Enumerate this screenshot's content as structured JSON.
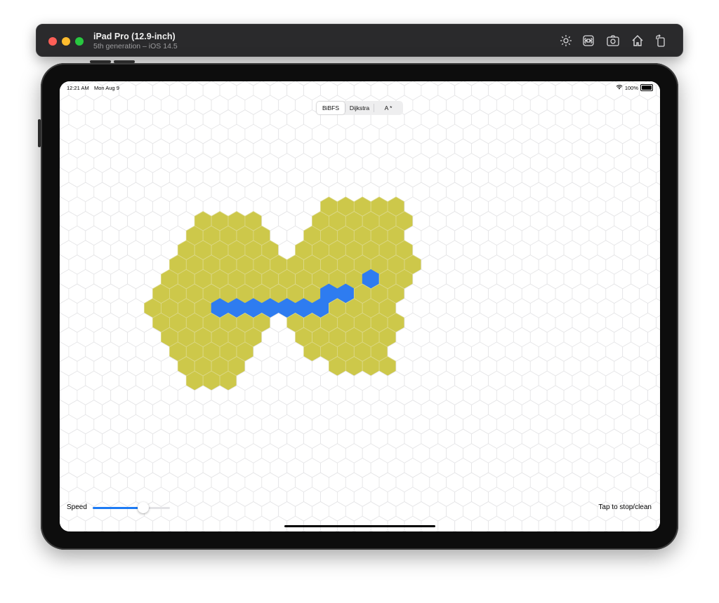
{
  "window": {
    "title": "iPad Pro (12.9-inch)",
    "subtitle": "5th generation – iOS 14.5",
    "toolbar_icons": [
      "brightness-icon",
      "command-icon",
      "screenshot-icon",
      "home-icon",
      "rotate-icon"
    ]
  },
  "status_bar": {
    "time": "12:21 AM",
    "date": "Mon Aug 9",
    "battery": "100%"
  },
  "segmented_control": {
    "options": [
      "BiBFS",
      "Dijkstra",
      "A *"
    ],
    "selected": "BiBFS"
  },
  "hex_grid": {
    "colors": {
      "empty_fill": "#ffffff",
      "empty_stroke": "#e4e4e6",
      "visited": "#cdc84a",
      "path": "#2e7cf0",
      "visited_stroke": "#dcd98a"
    },
    "visited_cells": [
      [
        3,
        9
      ],
      [
        4,
        9
      ],
      [
        5,
        9
      ],
      [
        6,
        9
      ],
      [
        3,
        10
      ],
      [
        4,
        10
      ],
      [
        5,
        10
      ],
      [
        6,
        10
      ],
      [
        7,
        10
      ],
      [
        2,
        11
      ],
      [
        3,
        11
      ],
      [
        4,
        11
      ],
      [
        5,
        11
      ],
      [
        6,
        11
      ],
      [
        7,
        11
      ],
      [
        2,
        12
      ],
      [
        3,
        12
      ],
      [
        4,
        12
      ],
      [
        5,
        12
      ],
      [
        6,
        12
      ],
      [
        7,
        12
      ],
      [
        8,
        12
      ],
      [
        1,
        13
      ],
      [
        2,
        13
      ],
      [
        3,
        13
      ],
      [
        4,
        13
      ],
      [
        5,
        13
      ],
      [
        6,
        13
      ],
      [
        7,
        13
      ],
      [
        8,
        13
      ],
      [
        1,
        14
      ],
      [
        2,
        14
      ],
      [
        3,
        14
      ],
      [
        4,
        14
      ],
      [
        5,
        14
      ],
      [
        6,
        14
      ],
      [
        7,
        14
      ],
      [
        8,
        14
      ],
      [
        9,
        14
      ],
      [
        0,
        15
      ],
      [
        1,
        15
      ],
      [
        2,
        15
      ],
      [
        3,
        15
      ],
      [
        4,
        15
      ],
      [
        5,
        15
      ],
      [
        6,
        15
      ],
      [
        7,
        15
      ],
      [
        8,
        15
      ],
      [
        1,
        16
      ],
      [
        2,
        16
      ],
      [
        3,
        16
      ],
      [
        4,
        16
      ],
      [
        5,
        16
      ],
      [
        6,
        16
      ],
      [
        7,
        16
      ],
      [
        1,
        17
      ],
      [
        2,
        17
      ],
      [
        3,
        17
      ],
      [
        4,
        17
      ],
      [
        5,
        17
      ],
      [
        6,
        17
      ],
      [
        2,
        18
      ],
      [
        3,
        18
      ],
      [
        4,
        18
      ],
      [
        5,
        18
      ],
      [
        6,
        18
      ],
      [
        2,
        19
      ],
      [
        3,
        19
      ],
      [
        4,
        19
      ],
      [
        5,
        19
      ],
      [
        3,
        20
      ],
      [
        4,
        20
      ],
      [
        5,
        20
      ],
      [
        11,
        8
      ],
      [
        12,
        8
      ],
      [
        13,
        8
      ],
      [
        14,
        8
      ],
      [
        15,
        8
      ],
      [
        10,
        9
      ],
      [
        11,
        9
      ],
      [
        12,
        9
      ],
      [
        13,
        9
      ],
      [
        14,
        9
      ],
      [
        15,
        9
      ],
      [
        10,
        10
      ],
      [
        11,
        10
      ],
      [
        12,
        10
      ],
      [
        13,
        10
      ],
      [
        14,
        10
      ],
      [
        15,
        10
      ],
      [
        9,
        11
      ],
      [
        10,
        11
      ],
      [
        11,
        11
      ],
      [
        12,
        11
      ],
      [
        13,
        11
      ],
      [
        14,
        11
      ],
      [
        15,
        11
      ],
      [
        9,
        12
      ],
      [
        10,
        12
      ],
      [
        11,
        12
      ],
      [
        12,
        12
      ],
      [
        13,
        12
      ],
      [
        14,
        12
      ],
      [
        15,
        12
      ],
      [
        16,
        12
      ],
      [
        9,
        13
      ],
      [
        10,
        13
      ],
      [
        11,
        13
      ],
      [
        12,
        13
      ],
      [
        13,
        13
      ],
      [
        14,
        13
      ],
      [
        15,
        13
      ],
      [
        9,
        14
      ],
      [
        10,
        14
      ],
      [
        11,
        14
      ],
      [
        12,
        14
      ],
      [
        13,
        14
      ],
      [
        14,
        14
      ],
      [
        15,
        14
      ],
      [
        9,
        15
      ],
      [
        10,
        15
      ],
      [
        11,
        15
      ],
      [
        12,
        15
      ],
      [
        13,
        15
      ],
      [
        14,
        15
      ],
      [
        9,
        16
      ],
      [
        10,
        16
      ],
      [
        11,
        16
      ],
      [
        12,
        16
      ],
      [
        13,
        16
      ],
      [
        14,
        16
      ],
      [
        15,
        16
      ],
      [
        9,
        17
      ],
      [
        10,
        17
      ],
      [
        11,
        17
      ],
      [
        12,
        17
      ],
      [
        13,
        17
      ],
      [
        14,
        17
      ],
      [
        10,
        18
      ],
      [
        11,
        18
      ],
      [
        12,
        18
      ],
      [
        13,
        18
      ],
      [
        14,
        18
      ],
      [
        11,
        19
      ],
      [
        12,
        19
      ],
      [
        13,
        19
      ],
      [
        14,
        19
      ]
    ],
    "path_cells": [
      [
        4,
        15
      ],
      [
        5,
        15
      ],
      [
        6,
        15
      ],
      [
        7,
        15
      ],
      [
        8,
        15
      ],
      [
        9,
        15
      ],
      [
        10,
        15
      ],
      [
        11,
        14
      ],
      [
        12,
        14
      ],
      [
        13,
        13
      ]
    ]
  },
  "controls": {
    "speed_label": "Speed",
    "speed_value": 0.65,
    "stop_label": "Tap to stop/clean"
  }
}
